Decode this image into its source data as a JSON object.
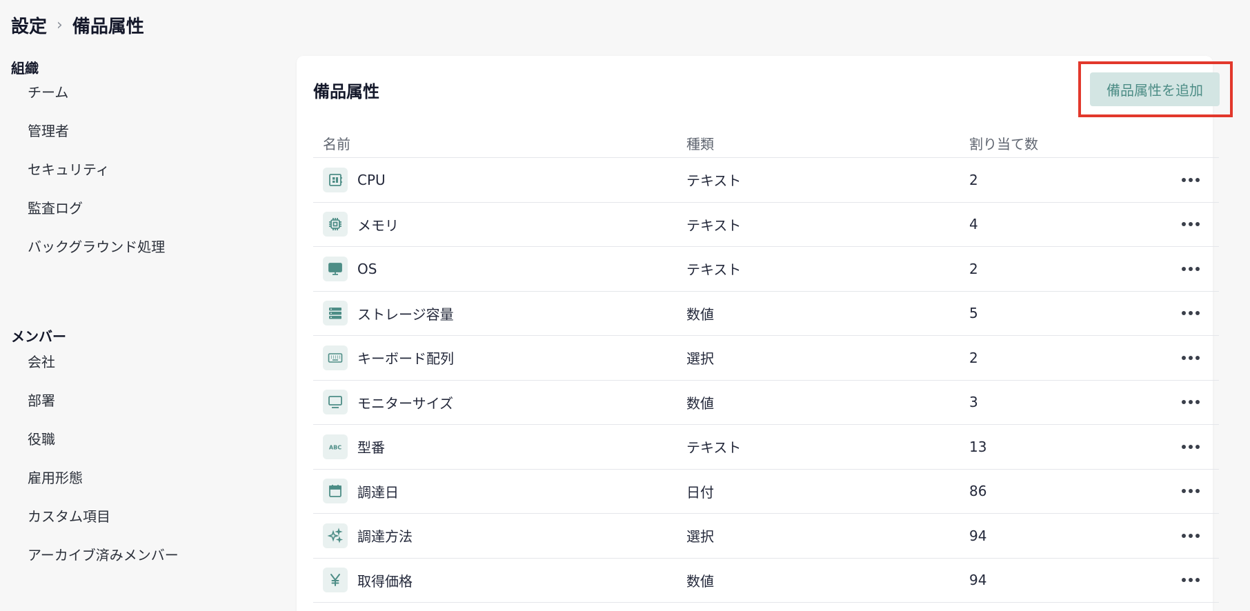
{
  "breadcrumb": {
    "root": "設定",
    "separator": "›",
    "current": "備品属性"
  },
  "sidebar": {
    "groups": [
      {
        "label": "組織",
        "items": [
          "チーム",
          "管理者",
          "セキュリティ",
          "監査ログ",
          "バックグラウンド処理"
        ]
      },
      {
        "label": "メンバー",
        "items": [
          "会社",
          "部署",
          "役職",
          "雇用形態",
          "カスタム項目",
          "アーカイブ済みメンバー"
        ]
      }
    ]
  },
  "main": {
    "title": "備品属性",
    "add_button_label": "備品属性を追加",
    "columns": {
      "name": "名前",
      "type": "種類",
      "count": "割り当て数"
    },
    "rows": [
      {
        "icon": "chip-icon",
        "name": "CPU",
        "type": "テキスト",
        "count": "2"
      },
      {
        "icon": "memory-icon",
        "name": "メモリ",
        "type": "テキスト",
        "count": "4"
      },
      {
        "icon": "desktop-icon",
        "name": "OS",
        "type": "テキスト",
        "count": "2"
      },
      {
        "icon": "storage-icon",
        "name": "ストレージ容量",
        "type": "数値",
        "count": "5"
      },
      {
        "icon": "keyboard-icon",
        "name": "キーボード配列",
        "type": "選択",
        "count": "2"
      },
      {
        "icon": "monitor-icon",
        "name": "モニターサイズ",
        "type": "数値",
        "count": "3"
      },
      {
        "icon": "abc-icon",
        "name": "型番",
        "type": "テキスト",
        "count": "13"
      },
      {
        "icon": "calendar-icon",
        "name": "調達日",
        "type": "日付",
        "count": "86"
      },
      {
        "icon": "sparkle-icon",
        "name": "調達方法",
        "type": "選択",
        "count": "94"
      },
      {
        "icon": "yen-icon",
        "name": "取得価格",
        "type": "数値",
        "count": "94"
      }
    ]
  },
  "colors": {
    "accent": "#4d8d86",
    "accent_bg": "#d3e5e3",
    "highlight_outline": "#e2382c"
  }
}
